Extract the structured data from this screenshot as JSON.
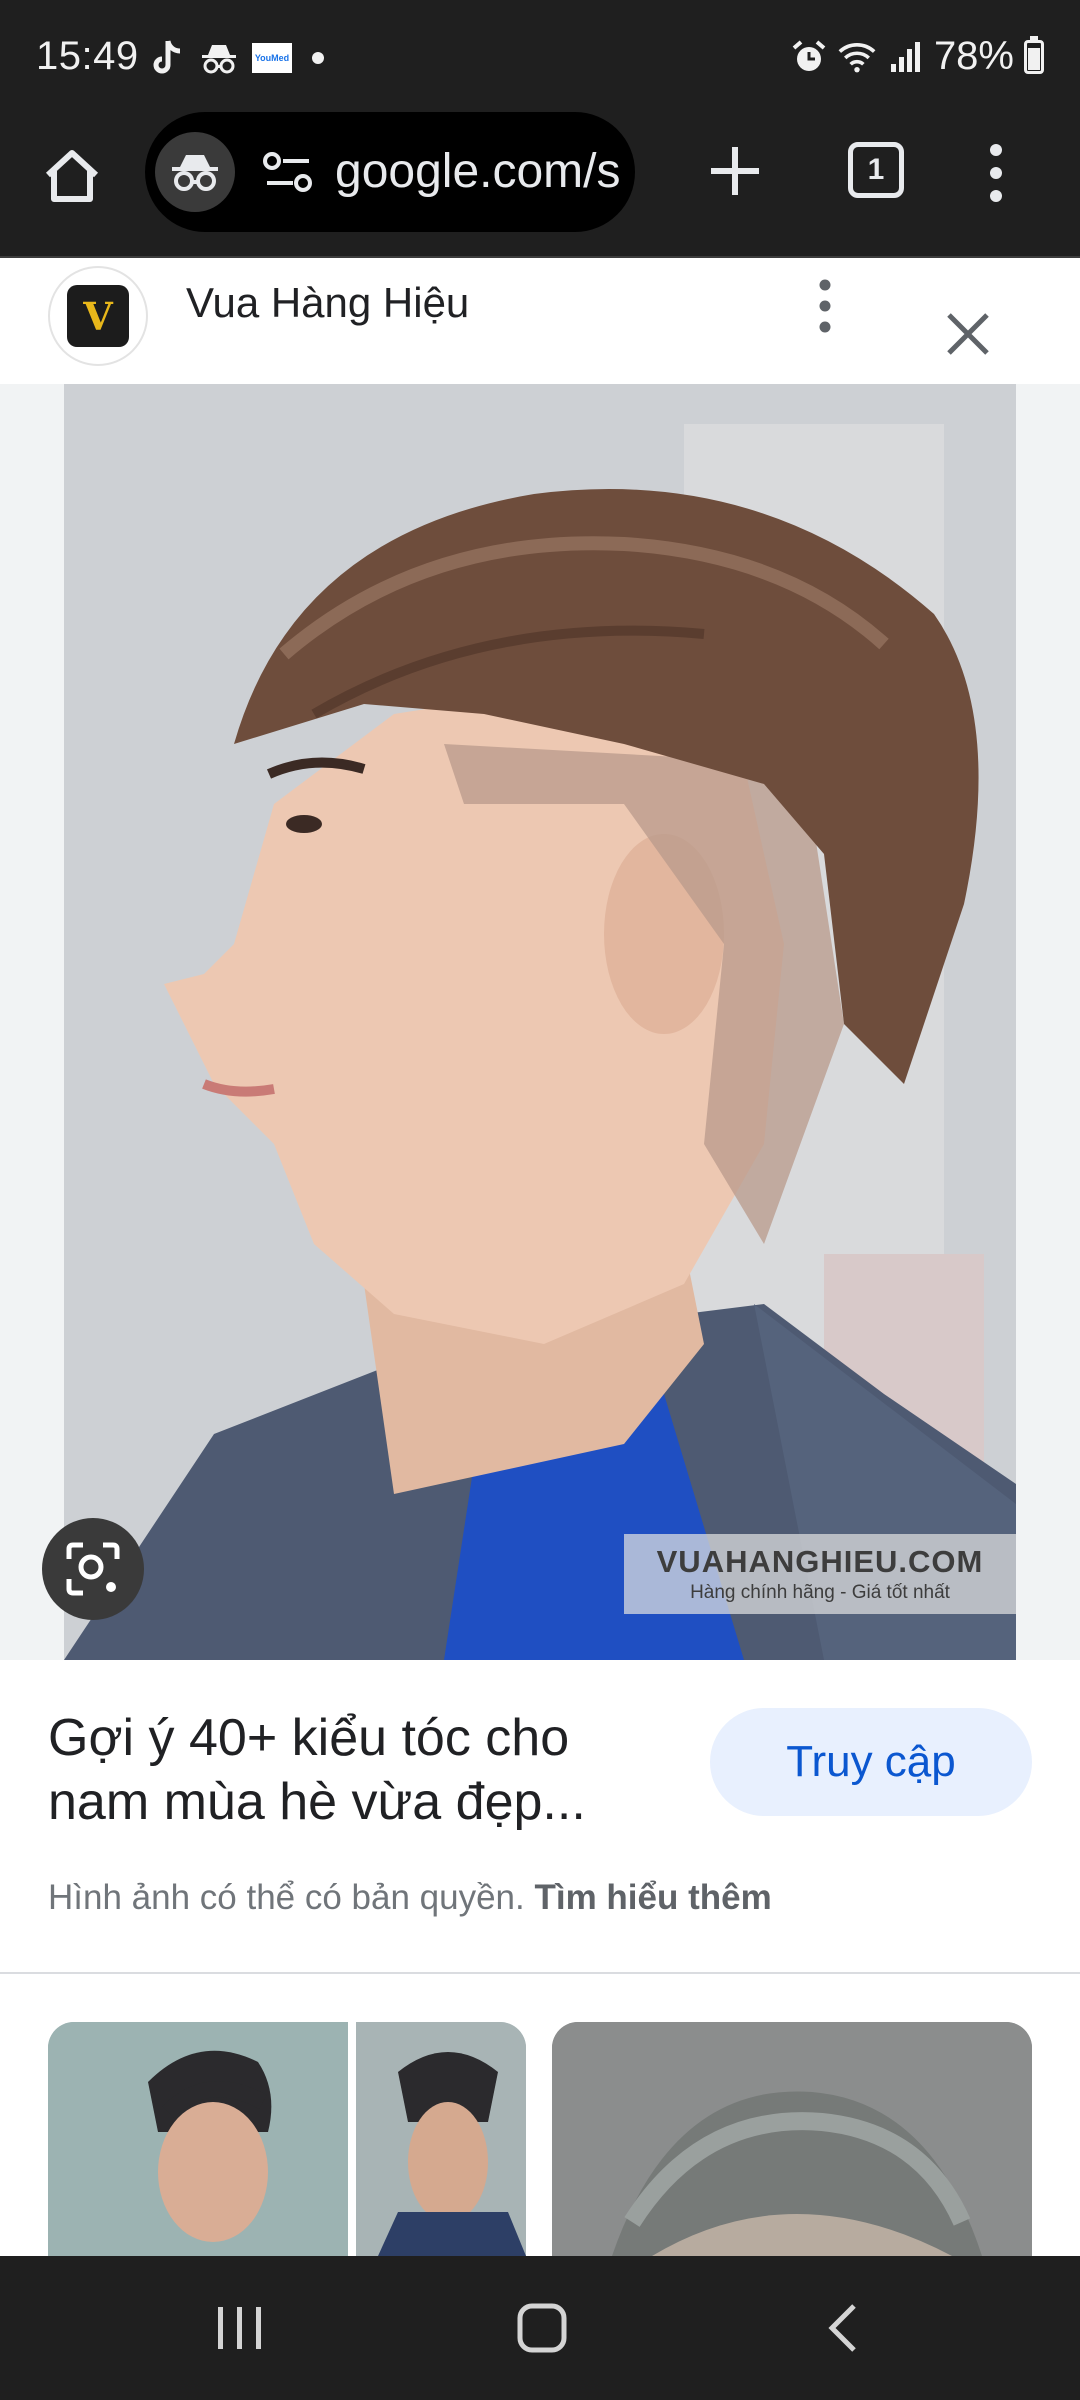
{
  "status_bar": {
    "time": "15:49",
    "notification_icons": [
      "tiktok-icon",
      "incognito-icon",
      "youmed-icon",
      "dot-icon"
    ],
    "youmed_label": "YouMed",
    "right_icons": [
      "alarm-icon",
      "wifi-icon",
      "signal-icon",
      "battery-icon"
    ],
    "battery": "78%"
  },
  "toolbar": {
    "url": "google.com/search",
    "tab_count": "1"
  },
  "source": {
    "logo_letter": "V",
    "name": "Vua Hàng Hiệu"
  },
  "image": {
    "watermark_title": "VUAHANGHIEU.COM",
    "watermark_subtitle": "Hàng chính hãng - Giá tốt nhất"
  },
  "result": {
    "title": "Gợi ý 40+ kiểu tóc cho nam mùa hè vừa đẹp...",
    "visit_label": "Truy cập",
    "copyright_text": "Hình ảnh có thể có bản quyền.",
    "learn_more": "Tìm hiểu thêm"
  },
  "colors": {
    "chrome_bg": "#1f1f1f",
    "visit_button_bg": "#e8f0fe",
    "visit_button_text": "#0b57d0"
  }
}
